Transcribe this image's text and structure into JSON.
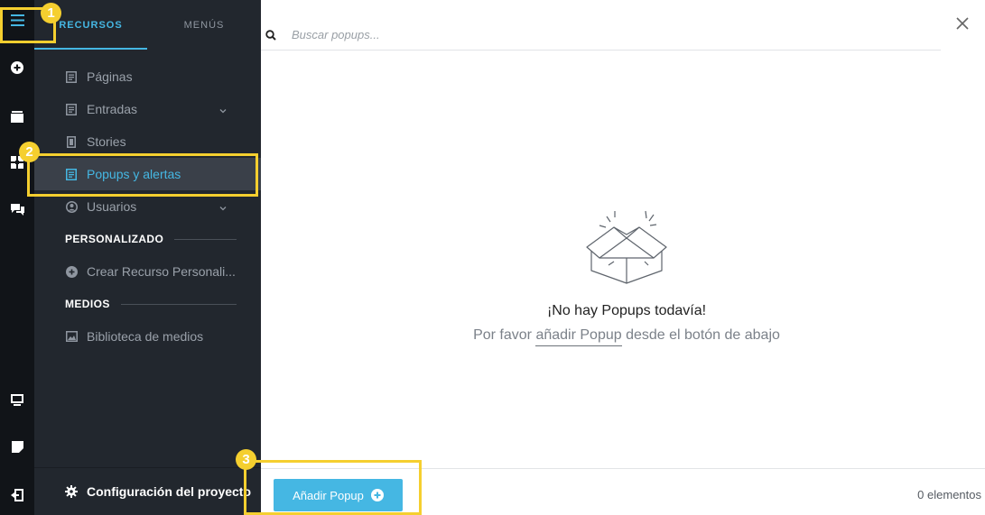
{
  "rail": {
    "icons": [
      "menu-icon",
      "plus-circle-icon",
      "folder-icon",
      "widgets-icon",
      "chat-icon",
      "desktop-icon",
      "sticky-note-icon",
      "exit-icon"
    ]
  },
  "sidebar": {
    "tabs": [
      {
        "label": "RECURSOS",
        "active": true
      },
      {
        "label": "MENÚS",
        "active": false
      }
    ],
    "items": [
      {
        "label": "Páginas",
        "icon": "page-icon"
      },
      {
        "label": "Entradas",
        "icon": "page-icon",
        "has_chevron": true
      },
      {
        "label": "Stories",
        "icon": "story-icon"
      },
      {
        "label": "Popups y alertas",
        "icon": "page-icon",
        "active": true
      },
      {
        "label": "Usuarios",
        "icon": "user-circle-icon",
        "has_chevron": true
      }
    ],
    "custom_section": {
      "title": "PERSONALIZADO",
      "items": [
        {
          "label": "Crear Recurso Personali...",
          "icon": "plus-circle-icon"
        }
      ]
    },
    "media_section": {
      "title": "MEDIOS",
      "items": [
        {
          "label": "Biblioteca de medios",
          "icon": "image-icon"
        }
      ]
    },
    "settings_label": "Configuración del proyecto"
  },
  "main": {
    "search": {
      "placeholder": "Buscar popups...",
      "value": ""
    },
    "empty_state": {
      "title": "¡No hay Popups todavía!",
      "subtitle_before": "Por favor",
      "subtitle_link": "añadir Popup",
      "subtitle_after": "desde el botón de abajo"
    },
    "add_button_label": "Añadir Popup",
    "count_label": "0 elementos"
  },
  "annotations": [
    "1",
    "2",
    "3"
  ],
  "colors": {
    "accent": "#45b7e3",
    "rail_bg": "#111418",
    "sidebar_bg": "#22272e",
    "active_bg": "#3a4049",
    "callout": "#f5cf2f"
  }
}
